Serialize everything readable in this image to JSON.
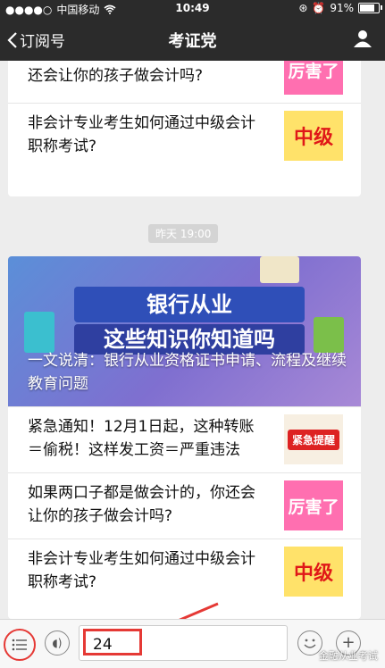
{
  "status": {
    "carrier": "中国移动",
    "time": "10:49",
    "battery": "91%",
    "battery_level": 0.91
  },
  "nav": {
    "back_label": "订阅号",
    "title": "考证党"
  },
  "articles_top": [
    {
      "title": "还会让你的孩子做会计吗?",
      "thumb": "厉害了"
    },
    {
      "title": "非会计专业考生如何通过中级会计职称考试?",
      "thumb": "中级"
    }
  ],
  "timestamp": "昨天 19:00",
  "hero": {
    "band1": "银行从业",
    "band2": "这些知识你知道吗",
    "caption": "一文说清：银行从业资格证书申请、流程及继续教育问题"
  },
  "articles": [
    {
      "title": "紧急通知！12月1日起，这种转账＝偷税！这样发工资＝严重违法",
      "thumb": "紧急提醒"
    },
    {
      "title": "如果两口子都是做会计的，你还会让你的孩子做会计吗?",
      "thumb": "厉害了"
    },
    {
      "title": "非会计专业考生如何通过中级会计职称考试?",
      "thumb": "中级"
    }
  ],
  "toolbar": {
    "input_value": "24"
  },
  "watermark": "金融从业考试"
}
